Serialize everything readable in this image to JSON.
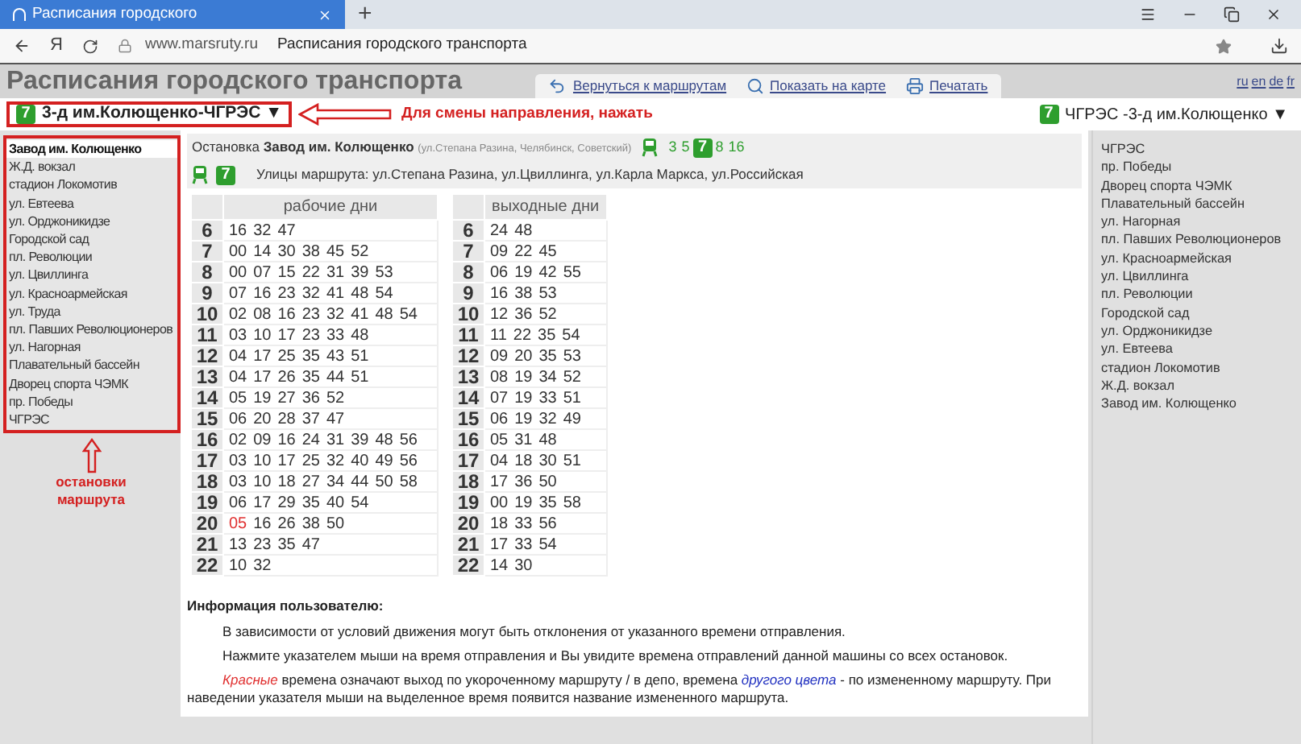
{
  "browser": {
    "tab_title": "Расписания городского",
    "new_tab": "+",
    "yandex": "Я",
    "url": "www.marsruty.ru",
    "page_title": "Расписания городского транспорта"
  },
  "site": {
    "title": "Расписания городского транспорта",
    "links": [
      {
        "label": "Вернуться к маршрутам",
        "kind": "back"
      },
      {
        "label": "Показать на карте",
        "kind": "map"
      },
      {
        "label": "Печатать",
        "kind": "print"
      }
    ],
    "languages": [
      "ru",
      "en",
      "de",
      "fr"
    ]
  },
  "direction": {
    "route_number": "7",
    "name": "3-д им.Колющенко-ЧГРЭС",
    "arrow": "▼"
  },
  "annotation_direction": "Для смены направления, нажать",
  "reverse_direction": {
    "route_number": "7",
    "name": "ЧГРЭС -3-д им.Колющенко",
    "arrow": "▼"
  },
  "stops": [
    {
      "name": "Завод им. Колющенко",
      "selected": true
    },
    {
      "name": "Ж.Д. вокзал",
      "selected": false
    },
    {
      "name": "стадион Локомотив",
      "selected": false
    },
    {
      "name": "ул. Евтеева",
      "selected": false
    },
    {
      "name": "ул. Орджоникидзе",
      "selected": false
    },
    {
      "name": "Городской сад",
      "selected": false
    },
    {
      "name": "пл. Революции",
      "selected": false
    },
    {
      "name": "ул. Цвиллинга",
      "selected": false
    },
    {
      "name": "ул. Красноармейская",
      "selected": false
    },
    {
      "name": "ул. Труда",
      "selected": false
    },
    {
      "name": "пл. Павших Революционеров",
      "selected": false
    },
    {
      "name": "ул. Нагорная",
      "selected": false
    },
    {
      "name": "Плавательный бассейн",
      "selected": false
    },
    {
      "name": "Дворец спорта ЧЭМК",
      "selected": false
    },
    {
      "name": "пр. Победы",
      "selected": false
    },
    {
      "name": "ЧГРЭС",
      "selected": false
    }
  ],
  "annotation_stops": "остановки маршрута",
  "stop_info": {
    "label": "Остановка",
    "name": "Завод им. Колющенко",
    "streets_note": "(ул.Степана Разина, Челябинск, Советский)",
    "tram_routes": [
      {
        "number": "3",
        "current": false
      },
      {
        "number": "5",
        "current": false
      },
      {
        "number": "7",
        "current": true
      },
      {
        "number": "8",
        "current": false
      },
      {
        "number": "16",
        "current": false
      }
    ],
    "route_number": "7",
    "streets": "Улицы маршрута: ул.Степана Разина, ул.Цвиллинга, ул.Карла Маркса, ул.Российская"
  },
  "timetables": [
    {
      "title": "рабочие дни",
      "rows": [
        {
          "hour": "6",
          "short_times": [],
          "times": [
            "16",
            "32",
            "47"
          ]
        },
        {
          "hour": "7",
          "short_times": [],
          "times": [
            "00",
            "14",
            "30",
            "38",
            "45",
            "52"
          ]
        },
        {
          "hour": "8",
          "short_times": [],
          "times": [
            "00",
            "07",
            "15",
            "22",
            "31",
            "39",
            "53"
          ]
        },
        {
          "hour": "9",
          "short_times": [],
          "times": [
            "07",
            "16",
            "23",
            "32",
            "41",
            "48",
            "54"
          ]
        },
        {
          "hour": "10",
          "short_times": [],
          "times": [
            "02",
            "08",
            "16",
            "23",
            "32",
            "41",
            "48",
            "54"
          ]
        },
        {
          "hour": "11",
          "short_times": [],
          "times": [
            "03",
            "10",
            "17",
            "23",
            "33",
            "48"
          ]
        },
        {
          "hour": "12",
          "short_times": [],
          "times": [
            "04",
            "17",
            "25",
            "35",
            "43",
            "51"
          ]
        },
        {
          "hour": "13",
          "short_times": [],
          "times": [
            "04",
            "17",
            "26",
            "35",
            "44",
            "51"
          ]
        },
        {
          "hour": "14",
          "short_times": [],
          "times": [
            "05",
            "19",
            "27",
            "36",
            "52"
          ]
        },
        {
          "hour": "15",
          "short_times": [],
          "times": [
            "06",
            "20",
            "28",
            "37",
            "47"
          ]
        },
        {
          "hour": "16",
          "short_times": [],
          "times": [
            "02",
            "09",
            "16",
            "24",
            "31",
            "39",
            "48",
            "56"
          ]
        },
        {
          "hour": "17",
          "short_times": [],
          "times": [
            "03",
            "10",
            "17",
            "25",
            "32",
            "40",
            "49",
            "56"
          ]
        },
        {
          "hour": "18",
          "short_times": [],
          "times": [
            "03",
            "10",
            "18",
            "27",
            "34",
            "44",
            "50",
            "58"
          ]
        },
        {
          "hour": "19",
          "short_times": [],
          "times": [
            "06",
            "17",
            "29",
            "35",
            "40",
            "54"
          ]
        },
        {
          "hour": "20",
          "short_times": [
            "05"
          ],
          "times": [
            "16",
            "26",
            "38",
            "50"
          ]
        },
        {
          "hour": "21",
          "short_times": [],
          "times": [
            "13",
            "23",
            "35",
            "47"
          ]
        },
        {
          "hour": "22",
          "short_times": [],
          "times": [
            "10",
            "32"
          ]
        }
      ]
    },
    {
      "title": "выходные дни",
      "rows": [
        {
          "hour": "6",
          "short_times": [],
          "times": [
            "24",
            "48"
          ]
        },
        {
          "hour": "7",
          "short_times": [],
          "times": [
            "09",
            "22",
            "45"
          ]
        },
        {
          "hour": "8",
          "short_times": [],
          "times": [
            "06",
            "19",
            "42",
            "55"
          ]
        },
        {
          "hour": "9",
          "short_times": [],
          "times": [
            "16",
            "38",
            "53"
          ]
        },
        {
          "hour": "10",
          "short_times": [],
          "times": [
            "12",
            "36",
            "52"
          ]
        },
        {
          "hour": "11",
          "short_times": [],
          "times": [
            "11",
            "22",
            "35",
            "54"
          ]
        },
        {
          "hour": "12",
          "short_times": [],
          "times": [
            "09",
            "20",
            "35",
            "53"
          ]
        },
        {
          "hour": "13",
          "short_times": [],
          "times": [
            "08",
            "19",
            "34",
            "52"
          ]
        },
        {
          "hour": "14",
          "short_times": [],
          "times": [
            "07",
            "19",
            "33",
            "51"
          ]
        },
        {
          "hour": "15",
          "short_times": [],
          "times": [
            "06",
            "19",
            "32",
            "49"
          ]
        },
        {
          "hour": "16",
          "short_times": [],
          "times": [
            "05",
            "31",
            "48"
          ]
        },
        {
          "hour": "17",
          "short_times": [],
          "times": [
            "04",
            "18",
            "30",
            "51"
          ]
        },
        {
          "hour": "18",
          "short_times": [],
          "times": [
            "17",
            "36",
            "50"
          ]
        },
        {
          "hour": "19",
          "short_times": [],
          "times": [
            "00",
            "19",
            "35",
            "58"
          ]
        },
        {
          "hour": "20",
          "short_times": [],
          "times": [
            "18",
            "33",
            "56"
          ]
        },
        {
          "hour": "21",
          "short_times": [],
          "times": [
            "17",
            "33",
            "54"
          ]
        },
        {
          "hour": "22",
          "short_times": [],
          "times": [
            "14",
            "30"
          ]
        }
      ]
    }
  ],
  "info": {
    "title": "Информация пользователю:",
    "paragraphs": [
      [
        {
          "text": "В зависимости от условий движения могут быть отклонения от указанного времени отправления.",
          "kind": "plain"
        }
      ],
      [
        {
          "text": "Нажмите указателем мыши на время отправления и Вы увидите времена отправлений данной машины со всех остановок.",
          "kind": "plain"
        }
      ],
      [
        {
          "text": "Красные",
          "kind": "red"
        },
        {
          "text": " времена означают выход по укороченному маршруту / в депо, времена ",
          "kind": "plain"
        },
        {
          "text": "другого цвета",
          "kind": "blue"
        },
        {
          "text": " - по измененному маршруту. При наведении указателя мыши на выделенное время появится название измененного маршрута.",
          "kind": "plain"
        }
      ]
    ]
  },
  "reverse_stops": [
    "ЧГРЭС",
    "пр. Победы",
    "Дворец спорта ЧЭМК",
    "Плавательный бассейн",
    "ул. Нагорная",
    "пл. Павших Революционеров",
    "ул. Красноармейская",
    "ул. Цвиллинга",
    "пл. Революции",
    "Городской сад",
    "ул. Орджоникидзе",
    "ул. Евтеева",
    "стадион Локомотив",
    "Ж.Д. вокзал",
    "Завод им. Колющенко"
  ]
}
